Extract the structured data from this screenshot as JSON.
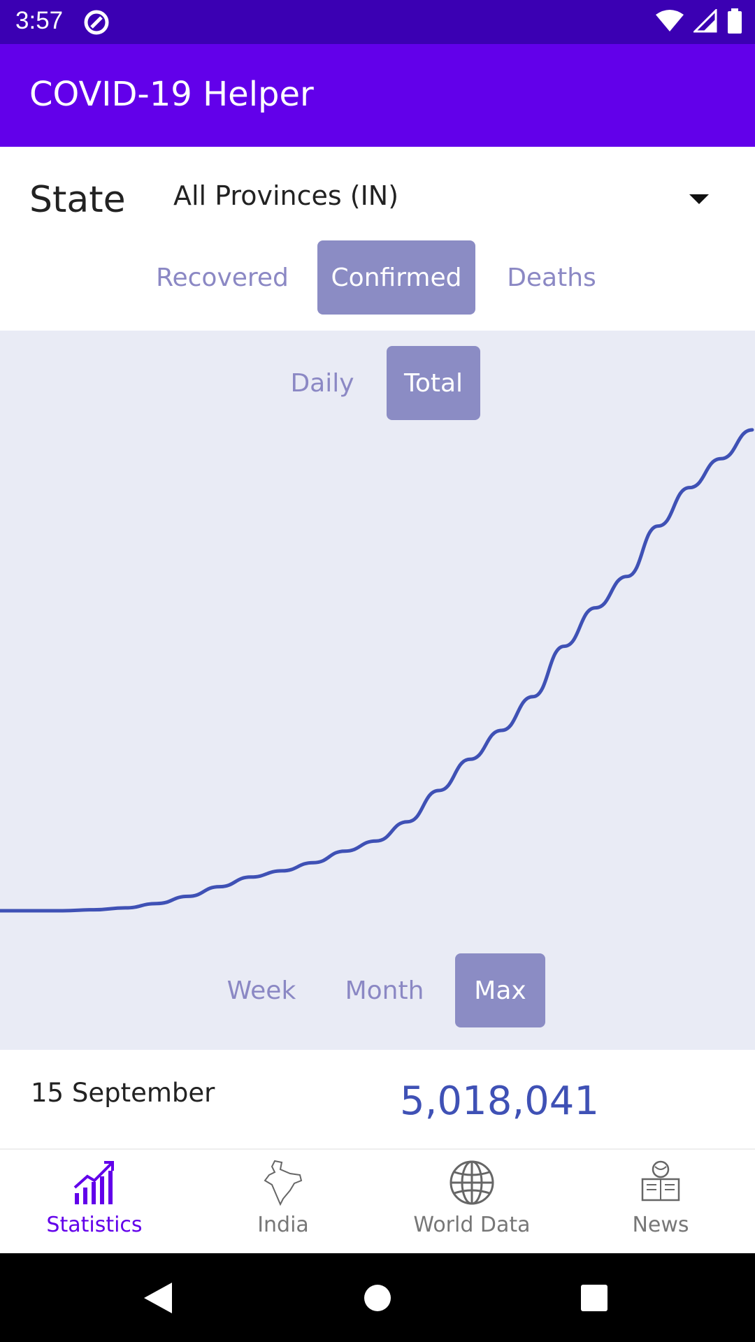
{
  "status_bar": {
    "time": "3:57"
  },
  "app_bar": {
    "title": "COVID-19 Helper"
  },
  "state": {
    "label": "State",
    "selected": "All Provinces (IN)"
  },
  "metric_tabs": [
    {
      "label": "Recovered",
      "active": false
    },
    {
      "label": "Confirmed",
      "active": true
    },
    {
      "label": "Deaths",
      "active": false
    }
  ],
  "mode_tabs": [
    {
      "label": "Daily",
      "active": false
    },
    {
      "label": "Total",
      "active": true
    }
  ],
  "range_tabs": [
    {
      "label": "Week",
      "active": false
    },
    {
      "label": "Month",
      "active": false
    },
    {
      "label": "Max",
      "active": true
    }
  ],
  "info": {
    "date": "15 September",
    "value": "5,018,041"
  },
  "bottom_nav": [
    {
      "label": "Statistics",
      "icon": "chart-up-icon",
      "active": true
    },
    {
      "label": "India",
      "icon": "india-map-icon",
      "active": false
    },
    {
      "label": "World Data",
      "icon": "globe-icon",
      "active": false
    },
    {
      "label": "News",
      "icon": "news-reader-icon",
      "active": false
    }
  ],
  "colors": {
    "accent": "#6200ea",
    "status_bar": "#3b00b3",
    "line": "#3f51b5",
    "chart_bg": "#e9ebf5",
    "toggle_active": "#8b8cc4"
  },
  "chart_data": {
    "type": "line",
    "series": [
      {
        "values": [
          0,
          0,
          0,
          0.2,
          0.6,
          1.5,
          3,
          5,
          7,
          8.3,
          10,
          12.4,
          14.5,
          18.5,
          25,
          31.5,
          37.5,
          44.5,
          55,
          63,
          69.5,
          80,
          88,
          94,
          100
        ]
      }
    ],
    "xlabel": "",
    "ylabel": "",
    "ylim": [
      0,
      100
    ]
  }
}
